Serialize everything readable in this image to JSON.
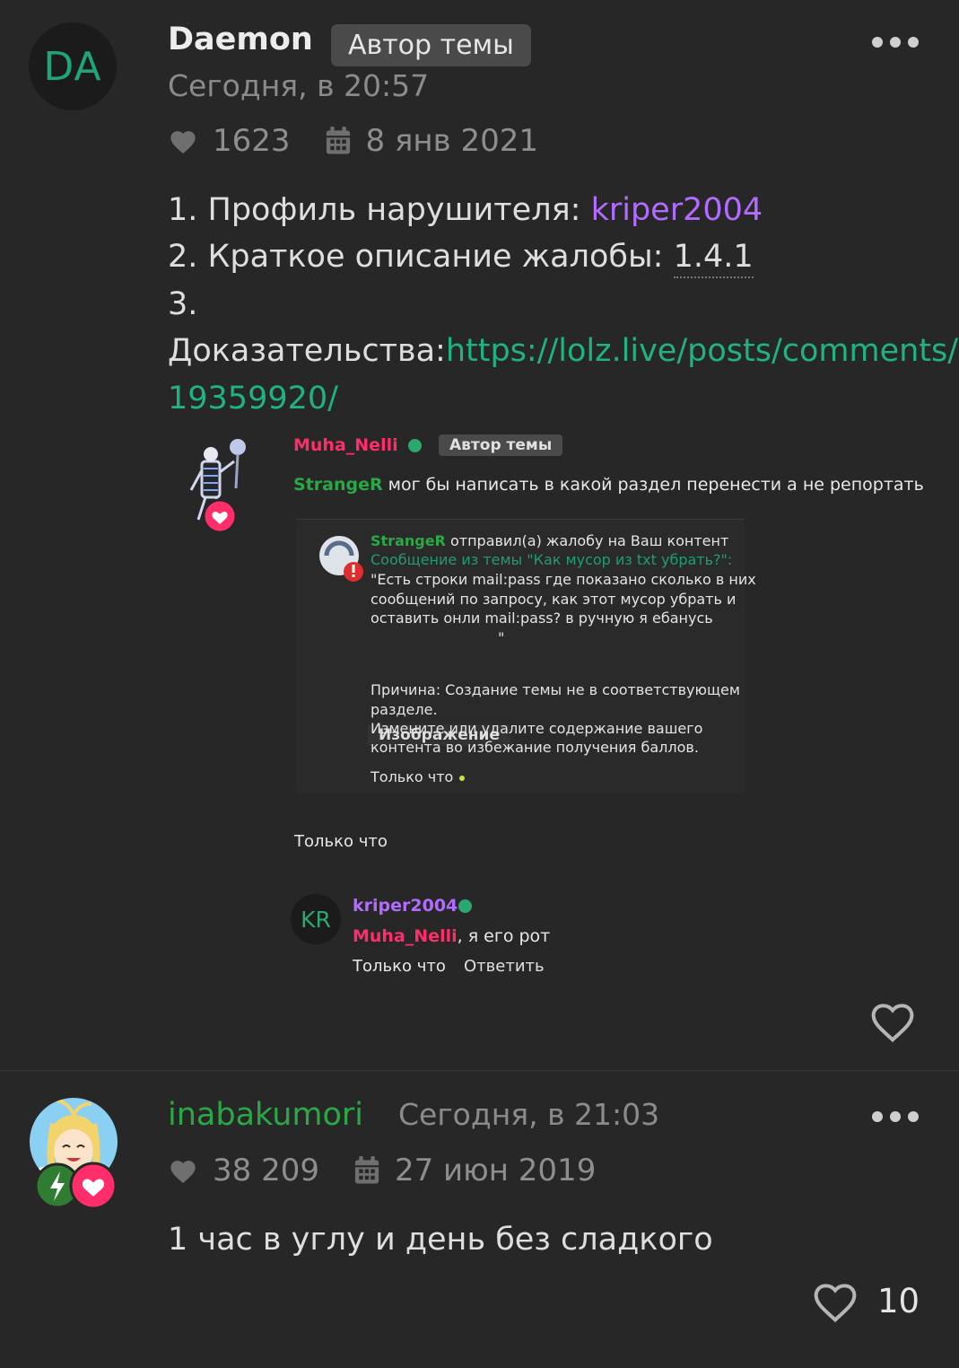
{
  "post1": {
    "avatar_initials": "DA",
    "username": "Daemon",
    "author_badge": "Автор темы",
    "timestamp": "Сегодня, в 20:57",
    "likes": "1623",
    "join_date": "8 янв 2021",
    "lines": {
      "l1_prefix": "1. Профиль нарушителя: ",
      "l1_link": "kriper2004",
      "l2_prefix": "2. Краткое описание жалобы: ",
      "l2_value": "1.4.1",
      "l3": "3.",
      "l4_prefix": "Доказательства:",
      "l4_link": "https://lolz.live/posts/comments/",
      "l5_link": "19359920/"
    },
    "screenshot": {
      "author_name": "Muha_Nelli",
      "author_badge": "Автор темы",
      "comment_name": "StrangeR",
      "comment_text": " мог бы написать в какой раздел перенести а не репортать",
      "notif_sender": "StrangeR",
      "notif_action": " отправил(а) жалобу на Ваш контент",
      "notif_topic": "Сообщение из темы \"Как мусор из txt убрать?\":",
      "notif_quote1": "\"Есть строки mail:pass где показано сколько в них",
      "notif_quote2": "сообщений по запросу, как этот мусор убрать и",
      "notif_quote3": "оставить онли mail:pass? в ручную я ебанусь",
      "notif_image": "Изображение",
      "notif_quote_end": "\"",
      "notif_reason1": "Причина: Создание темы не в соответствующем",
      "notif_reason2": "разделе.",
      "notif_reason3": "Измените или удалите содержание вашего",
      "notif_reason4": "контента во избежание получения баллов.",
      "notif_time": "Только что",
      "post_time": "Только что",
      "reply_avatar": "KR",
      "reply_name": "kriper2004",
      "reply_mention": "Muha_Nelli",
      "reply_text": ", я его рот",
      "reply_time": "Только что",
      "reply_action": "Ответить"
    }
  },
  "post2": {
    "username": "inabakumori",
    "timestamp": "Сегодня, в 21:03",
    "likes": "38 209",
    "join_date": "27 июн 2019",
    "text": "1 час в углу и день без сладкого",
    "like_count": "10"
  },
  "colors": {
    "background": "#272727",
    "link_green": "#1fb37f",
    "user_purple": "#b36bff",
    "user_green": "#2aa845",
    "user_pink": "#ff2d6a"
  }
}
